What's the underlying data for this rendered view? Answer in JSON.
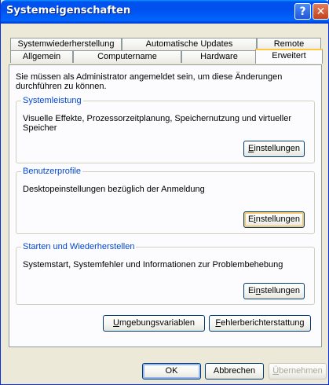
{
  "window": {
    "title": "Systemeigenschaften",
    "help_label": "?",
    "close_label": "✕"
  },
  "tabs_back": [
    {
      "label": "Systemwiederherstellung"
    },
    {
      "label": "Automatische Updates"
    },
    {
      "label": "Remote"
    }
  ],
  "tabs_front": [
    {
      "label": "Allgemein"
    },
    {
      "label": "Computername"
    },
    {
      "label": "Hardware"
    },
    {
      "label": "Erweitert"
    }
  ],
  "intro": "Sie müssen als Administrator angemeldet sein, um diese Änderungen durchführen zu können.",
  "groups": [
    {
      "title": "Systemleistung",
      "text": "Visuelle Effekte, Prozessorzeitplanung, Speichernutzung und virtueller Speicher",
      "button": {
        "pre": "",
        "acc": "E",
        "post": "instellungen"
      }
    },
    {
      "title": "Benutzerprofile",
      "text": "Desktopeinstellungen bezüglich der Anmeldung",
      "button": {
        "pre": "E",
        "acc": "i",
        "post": "nstellungen"
      }
    },
    {
      "title": "Starten und Wiederherstellen",
      "text": "Systemstart, Systemfehler und Informationen zur Problembehebung",
      "button": {
        "pre": "Ei",
        "acc": "n",
        "post": "stellungen"
      }
    }
  ],
  "env_button": {
    "acc": "U",
    "rest": "mgebungsvariablen"
  },
  "error_button": {
    "acc": "F",
    "rest": "ehlerberichterstattung"
  },
  "footer": {
    "ok_label": "OK",
    "cancel_label": "Abbrechen",
    "apply": {
      "acc": "Ü",
      "rest": "bernehmen"
    }
  },
  "colors": {
    "title_blue": "#0054e3",
    "group_title": "#0046d5",
    "focus_orange": "#f6c76a",
    "face": "#ece9d8"
  }
}
